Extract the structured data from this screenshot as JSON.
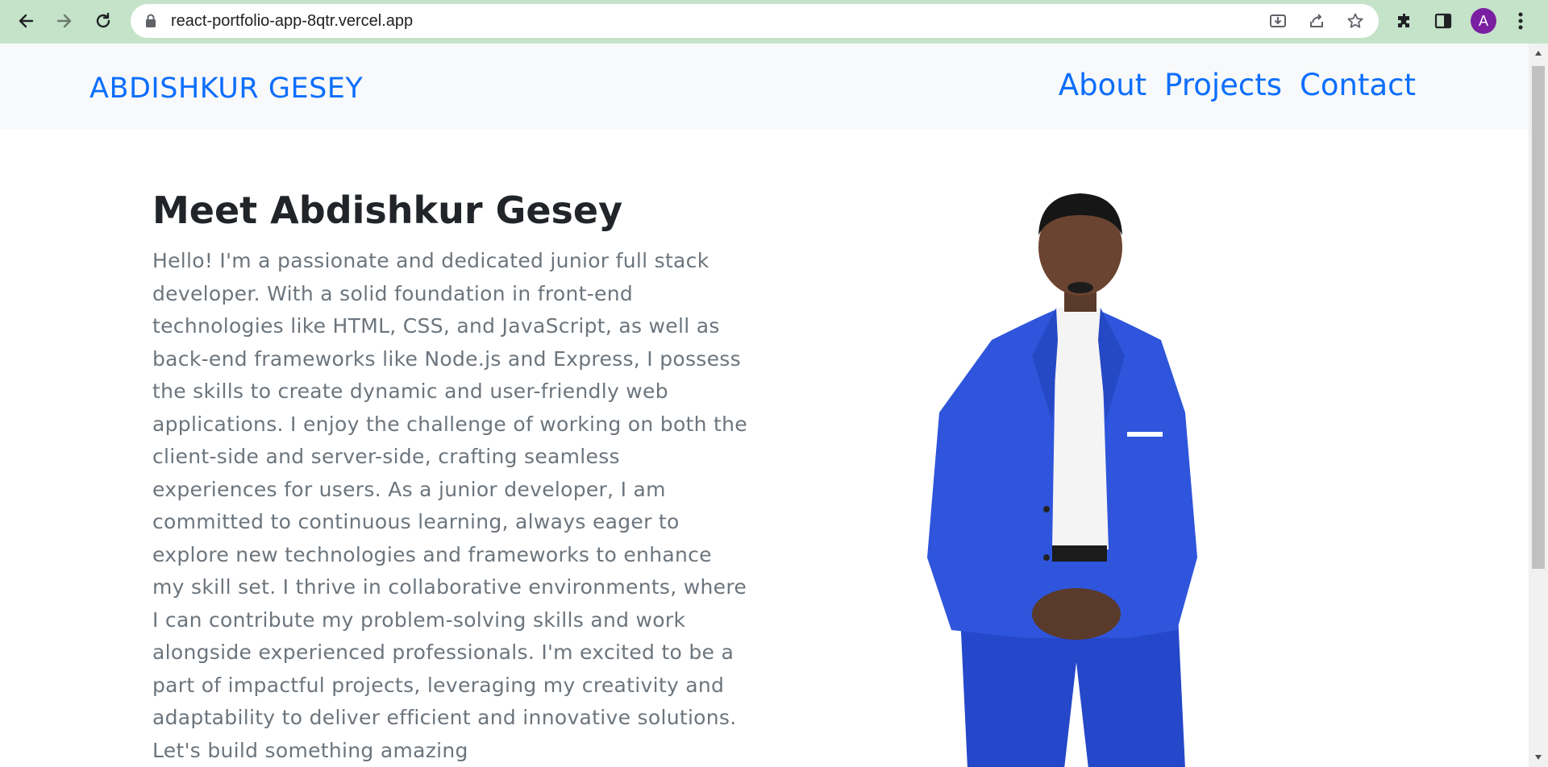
{
  "browser": {
    "url": "react-portfolio-app-8qtr.vercel.app",
    "profile_initial": "A",
    "icons": [
      "back-icon",
      "forward-icon",
      "reload-icon",
      "lock-icon",
      "install-icon",
      "share-icon",
      "bookmark-star-icon",
      "extensions-icon",
      "side-panel-icon",
      "more-menu-icon"
    ]
  },
  "navbar": {
    "brand": "ABDISHKUR GESEY",
    "links": [
      "About",
      "Projects",
      "Contact"
    ]
  },
  "hero": {
    "title": "Meet Abdishkur Gesey",
    "bio": "Hello! I'm a passionate and dedicated junior full stack developer. With a solid foundation in front-end technologies like HTML, CSS, and JavaScript, as well as back-end frameworks like Node.js and Express, I possess the skills to create dynamic and user-friendly web applications. I enjoy the challenge of working on both the client-side and server-side, crafting seamless experiences for users. As a junior developer, I am committed to continuous learning, always eager to explore new technologies and frameworks to enhance my skill set. I thrive in collaborative environments, where I can contribute my problem-solving skills and work alongside experienced professionals. I'm excited to be a part of impactful projects, leveraging my creativity and adaptability to deliver efficient and innovative solutions. Let's build something amazing"
  },
  "colors": {
    "toolbar": "#c4e3c9",
    "link": "#0d6efd",
    "heading": "#212529",
    "body_text": "#6c757d",
    "navbar_bg": "#f8f9fa",
    "suit": "#2a4fd8"
  }
}
